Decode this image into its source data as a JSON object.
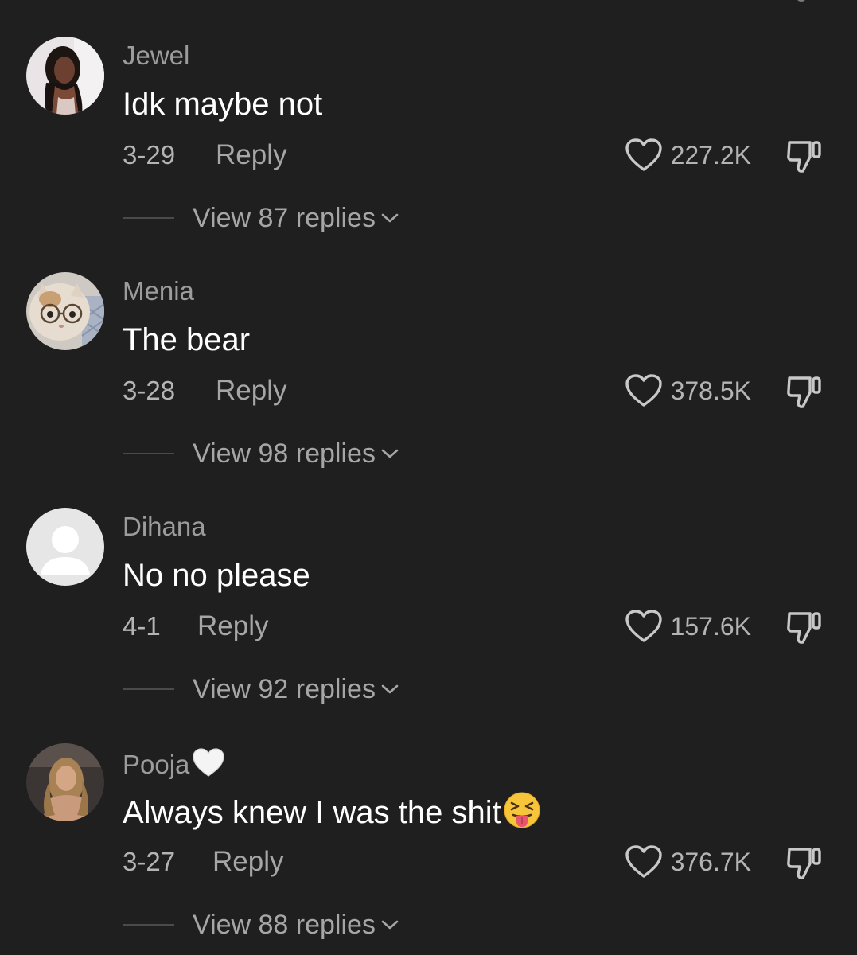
{
  "comments": [
    {
      "username": "Jewel",
      "text": "Idk maybe not",
      "date": "3-29",
      "reply_label": "Reply",
      "likes": "227.2K",
      "view_replies": "View 87 replies",
      "avatar": "photo"
    },
    {
      "username": "Menia",
      "text": "The bear",
      "date": "3-28",
      "reply_label": "Reply",
      "likes": "378.5K",
      "view_replies": "View 98 replies",
      "avatar": "cat-with-glasses"
    },
    {
      "username": "Dihana",
      "text": "No no please",
      "date": "4-1",
      "reply_label": "Reply",
      "likes": "157.6K",
      "view_replies": "View 92 replies",
      "avatar": "default-user-silhouette"
    },
    {
      "username": "Pooja",
      "username_suffix_emoji": "white-heart",
      "text": "Always knew I was the shit",
      "text_suffix_emoji": "squinting-face-with-tongue",
      "date": "3-27",
      "reply_label": "Reply",
      "likes": "376.7K",
      "view_replies": "View 88 replies",
      "avatar": "photo"
    }
  ],
  "colors": {
    "background": "#1f1f1f",
    "username": "#9c9c9c",
    "comment_text": "#ffffff",
    "meta_text": "#b4b4b4",
    "reply_text": "#a6a6a6",
    "divider": "#4a4a4a"
  },
  "icons": {
    "like": "heart-outline-icon",
    "dislike": "thumbs-down-icon",
    "expand": "chevron-down-icon"
  }
}
